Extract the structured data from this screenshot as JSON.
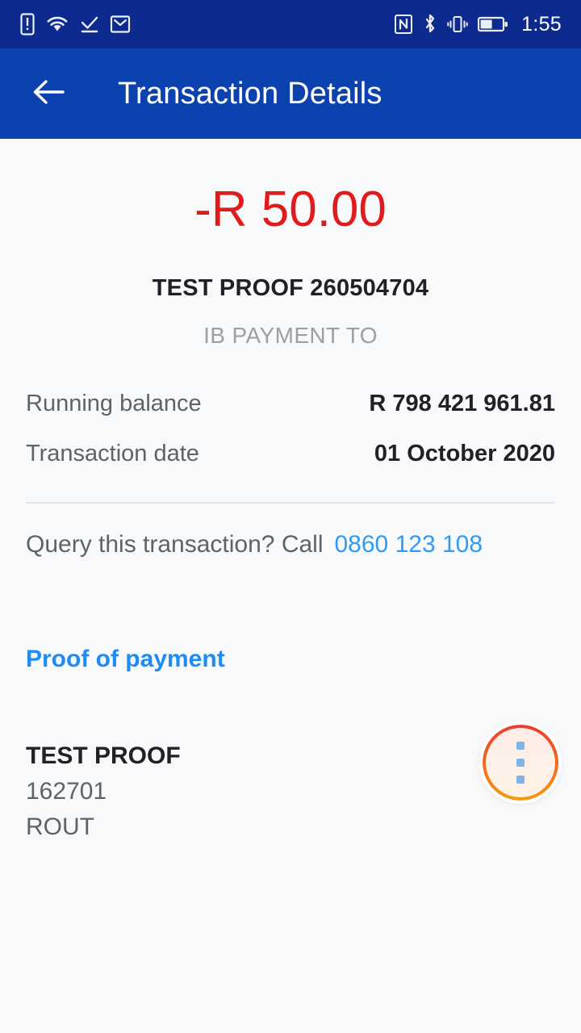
{
  "status_bar": {
    "icons_left": [
      "sim-alert-icon",
      "wifi-icon",
      "check-download-icon",
      "email-icon"
    ],
    "icons_right": [
      "nfc-icon",
      "bluetooth-icon",
      "vibrate-icon",
      "battery-icon"
    ],
    "time": "1:55",
    "battery_level_percent": 50,
    "background_color": "#0d2a8f"
  },
  "app_bar": {
    "back_icon": "back-arrow-icon",
    "title": "Transaction Details",
    "background_color": "#0c41b0"
  },
  "transaction": {
    "amount": "-R 50.00",
    "amount_color": "#e01b1b",
    "title": "TEST PROOF 260504704",
    "subtitle": "IB PAYMENT TO",
    "details": [
      {
        "label": "Running balance",
        "value": "R 798 421 961.81"
      },
      {
        "label": "Transaction date",
        "value": "01 October 2020"
      }
    ]
  },
  "query": {
    "text": "Query this transaction? Call",
    "phone": "0860 123 108",
    "phone_color": "#2f9bf5"
  },
  "proof_of_payment": {
    "link_label": "Proof of payment",
    "link_color": "#1f8bf5",
    "beneficiary_name": "TEST PROOF",
    "beneficiary_account": "162701",
    "beneficiary_reference": "ROUT"
  },
  "fab": {
    "icon": "more-options-vertical-icon",
    "ring_color_top": "#ee3b2f",
    "ring_color_bottom": "#f79a10",
    "dot_color": "#7fb4e8"
  }
}
